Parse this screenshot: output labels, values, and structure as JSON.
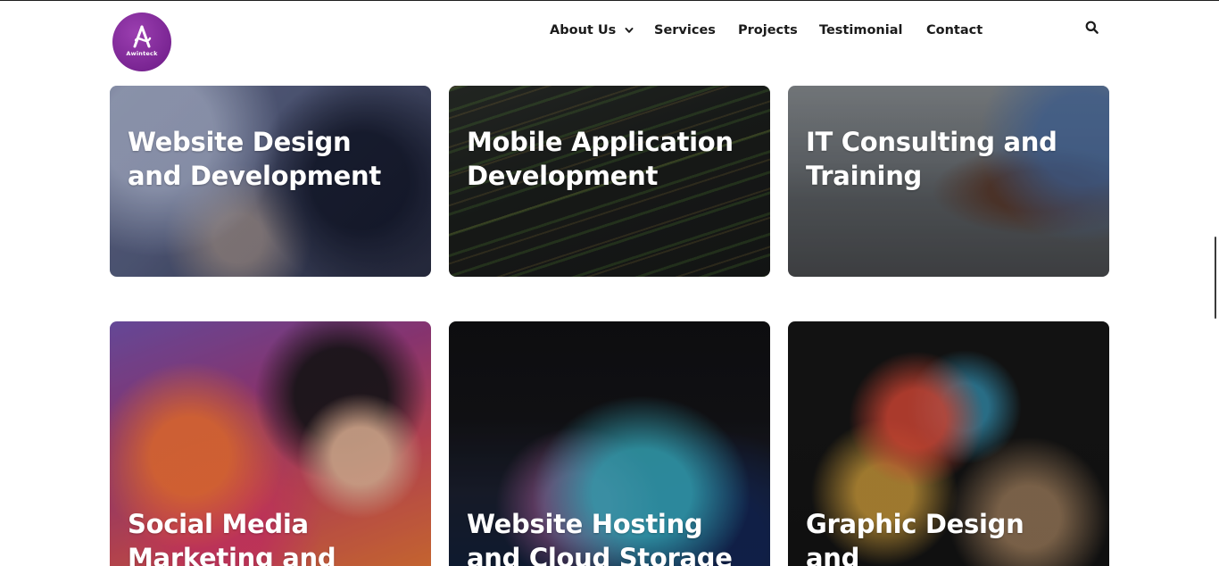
{
  "brand": {
    "logo_text": "Awinteck",
    "accent_color": "#7a2593"
  },
  "nav": {
    "items": [
      {
        "label": "About Us",
        "has_dropdown": true
      },
      {
        "label": "Services",
        "has_dropdown": false
      },
      {
        "label": "Projects",
        "has_dropdown": false
      },
      {
        "label": "Testimonial",
        "has_dropdown": false
      },
      {
        "label": "Contact",
        "has_dropdown": false
      }
    ],
    "search_icon": "search-icon",
    "dropdown_icon": "chevron-down-icon"
  },
  "services": {
    "cards": [
      {
        "title_line1": "Website Design",
        "title_line2": "and Development"
      },
      {
        "title_line1": "Mobile Application",
        "title_line2": "Development"
      },
      {
        "title_line1": "IT Consulting and",
        "title_line2": "Training"
      },
      {
        "title_line1": "Social Media",
        "title_line2": "Marketing and"
      },
      {
        "title_line1": "Website Hosting",
        "title_line2": "and Cloud Storage"
      },
      {
        "title_line1": "Graphic Design",
        "title_line2": "and"
      }
    ]
  }
}
